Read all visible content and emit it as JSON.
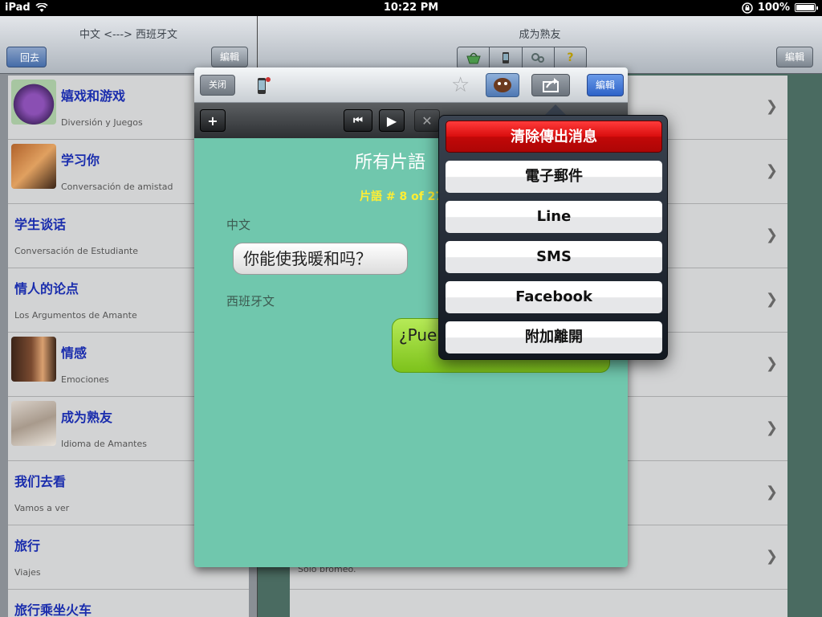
{
  "status": {
    "device": "iPad",
    "time": "10:22 PM",
    "battery": "100%"
  },
  "left": {
    "title": "中文 <---> 西班牙文",
    "back_label": "回去",
    "edit_label": "編輯",
    "items": [
      {
        "title": "嬉戏和游戏",
        "subtitle": "Diversión y Juegos"
      },
      {
        "title": "学习你",
        "subtitle": "Conversación de amistad"
      },
      {
        "title": "学生谈话",
        "subtitle": "Conversación de Estudiante"
      },
      {
        "title": "情人的论点",
        "subtitle": "Los Argumentos de Amante"
      },
      {
        "title": "情感",
        "subtitle": "Emociones"
      },
      {
        "title": "成为熟友",
        "subtitle": "Idioma de Amantes"
      },
      {
        "title": "我们去看",
        "subtitle": "Vamos a ver"
      },
      {
        "title": "旅行",
        "subtitle": "Viajes"
      },
      {
        "title": "旅行乘坐火车",
        "subtitle": ""
      }
    ]
  },
  "right": {
    "title": "成为熟友",
    "edit_label": "編輯",
    "segments": [
      "basket-icon",
      "phone-icon",
      "gears-icon",
      "help-icon"
    ],
    "help_glyph": "?",
    "last_row_text": "Sólo bromeo."
  },
  "modal": {
    "close_label": "关闭",
    "edit_label": "編輯",
    "phrase_title": "所有片語",
    "phrase_count": "片語 # 8 of 27",
    "lang1_label": "中文",
    "phrase_native": "你能使我暖和吗？",
    "lang2_label": "西班牙文",
    "phrase_foreign": "¿Pue"
  },
  "popover": {
    "items": [
      "清除傳出消息",
      "電子郵件",
      "Line",
      "SMS",
      "Facebook",
      "附加離開"
    ]
  }
}
